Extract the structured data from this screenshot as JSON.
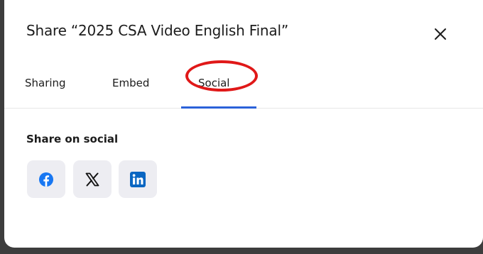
{
  "dialog": {
    "title": "Share “2025 CSA Video English Final”"
  },
  "tabs": [
    {
      "label": "Sharing"
    },
    {
      "label": "Embed"
    },
    {
      "label": "Social",
      "active": true
    }
  ],
  "social": {
    "heading": "Share on social",
    "buttons": [
      {
        "name": "facebook",
        "icon": "facebook-icon",
        "color": "#1877f2"
      },
      {
        "name": "x",
        "icon": "x-icon",
        "color": "#111111"
      },
      {
        "name": "linkedin",
        "icon": "linkedin-icon",
        "color": "#0a66c2"
      }
    ]
  },
  "colors": {
    "accent": "#2b62d9",
    "annotation": "#e01818",
    "button_bg": "#ededf2"
  }
}
